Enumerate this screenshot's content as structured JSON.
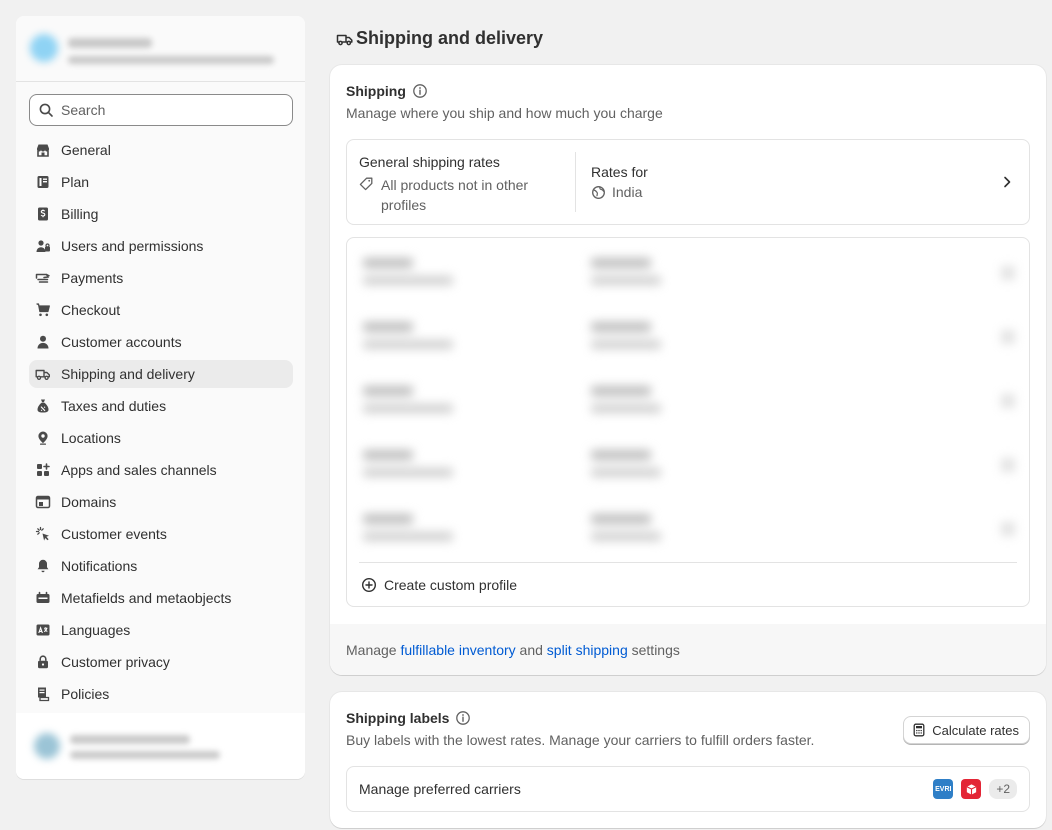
{
  "sidebar": {
    "search_placeholder": "Search",
    "items": [
      {
        "label": "General",
        "icon": "store-icon"
      },
      {
        "label": "Plan",
        "icon": "plan-icon"
      },
      {
        "label": "Billing",
        "icon": "billing-icon"
      },
      {
        "label": "Users and permissions",
        "icon": "users-icon"
      },
      {
        "label": "Payments",
        "icon": "payments-icon"
      },
      {
        "label": "Checkout",
        "icon": "cart-icon"
      },
      {
        "label": "Customer accounts",
        "icon": "person-icon"
      },
      {
        "label": "Shipping and delivery",
        "icon": "truck-icon",
        "active": true
      },
      {
        "label": "Taxes and duties",
        "icon": "tax-icon"
      },
      {
        "label": "Locations",
        "icon": "location-icon"
      },
      {
        "label": "Apps and sales channels",
        "icon": "apps-icon"
      },
      {
        "label": "Domains",
        "icon": "domains-icon"
      },
      {
        "label": "Customer events",
        "icon": "cursor-icon"
      },
      {
        "label": "Notifications",
        "icon": "bell-icon"
      },
      {
        "label": "Metafields and metaobjects",
        "icon": "metafields-icon"
      },
      {
        "label": "Languages",
        "icon": "languages-icon"
      },
      {
        "label": "Customer privacy",
        "icon": "lock-icon"
      },
      {
        "label": "Policies",
        "icon": "policies-icon"
      }
    ]
  },
  "page": {
    "title": "Shipping and delivery"
  },
  "shipping": {
    "title": "Shipping",
    "subtitle": "Manage where you ship and how much you charge",
    "general_rates": {
      "title": "General shipping rates",
      "desc": "All products not in other profiles",
      "rates_for_label": "Rates for",
      "country": "India"
    },
    "create_profile": "Create custom profile",
    "footer": {
      "prefix": "Manage",
      "link1": "fulfillable inventory",
      "middle": "and",
      "link2": "split shipping",
      "suffix": "settings"
    }
  },
  "labels": {
    "title": "Shipping labels",
    "subtitle": "Buy labels with the lowest rates. Manage your carriers to fulfill orders faster.",
    "calc_button": "Calculate rates",
    "carriers_label": "Manage preferred carriers",
    "carrier_logo_text": "EVRI",
    "more_carriers": "+2"
  },
  "colors": {
    "link": "#005bd3",
    "active_nav": "#ebebeb",
    "background": "#f1f1f1"
  }
}
